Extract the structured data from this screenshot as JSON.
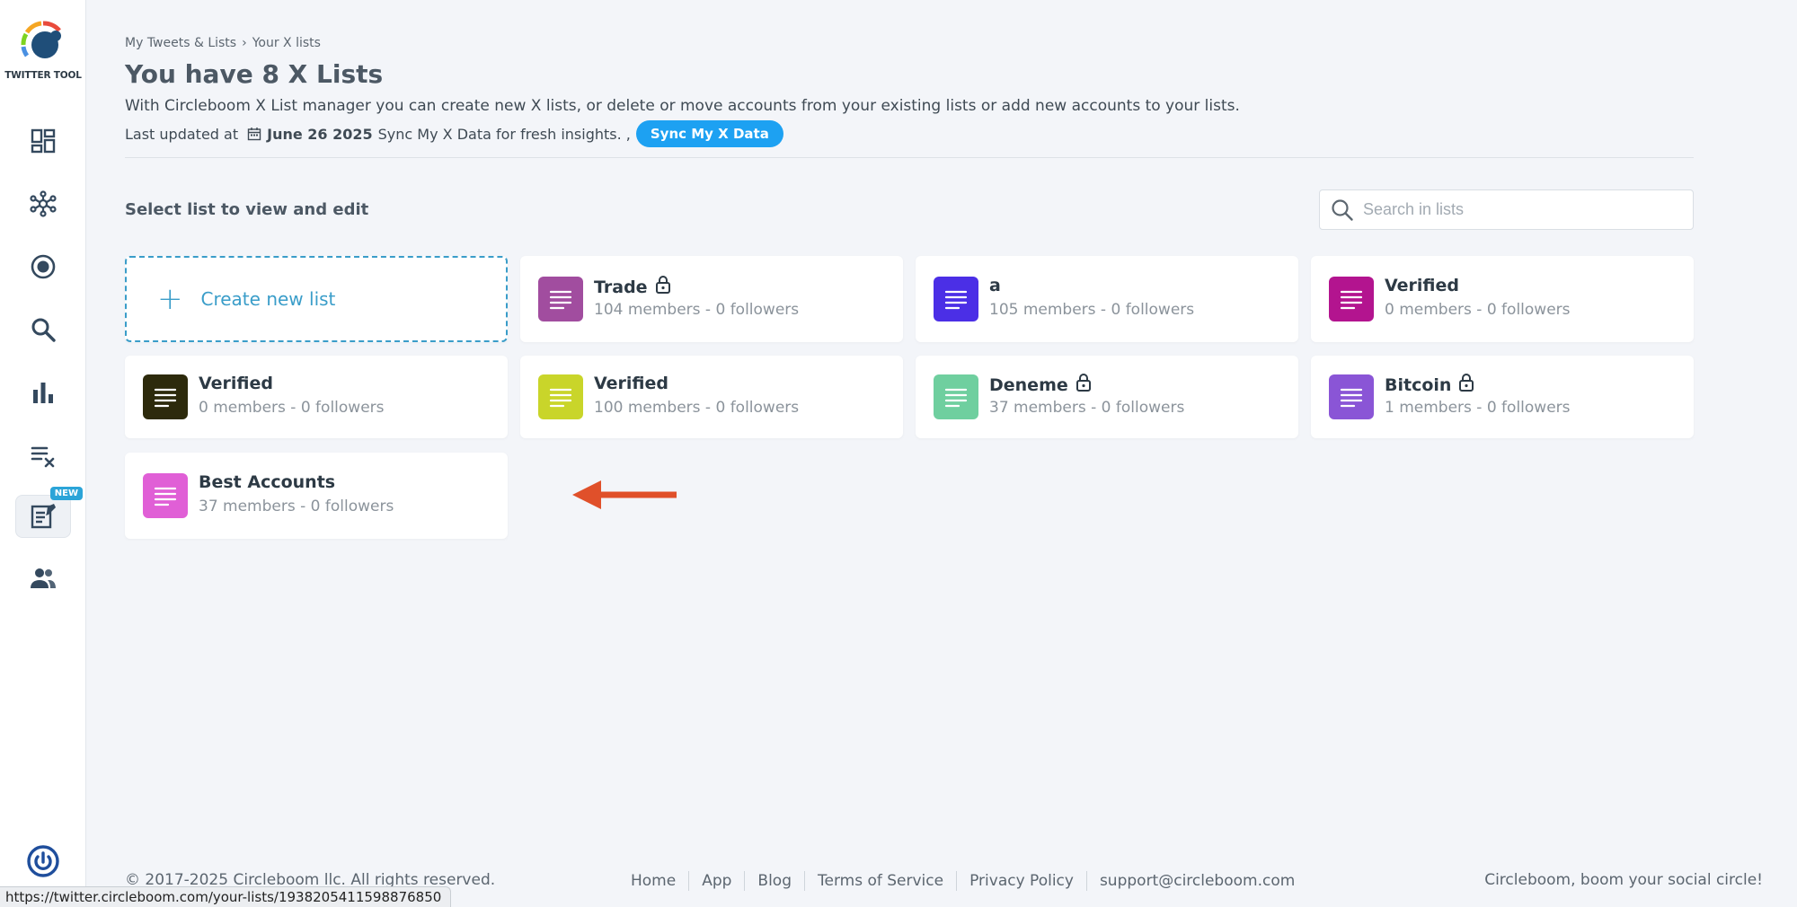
{
  "app": {
    "logo_text": "TWITTER TOOL",
    "new_badge": "NEW"
  },
  "sidebar": {
    "items": [
      {
        "icon": "dashboard-icon"
      },
      {
        "icon": "network-icon"
      },
      {
        "icon": "target-icon"
      },
      {
        "icon": "search-icon"
      },
      {
        "icon": "bar-chart-icon"
      },
      {
        "icon": "list-remove-icon"
      },
      {
        "icon": "list-edit-icon",
        "active": true
      },
      {
        "icon": "users-icon"
      }
    ]
  },
  "breadcrumb": {
    "parent": "My Tweets & Lists",
    "current": "Your X lists"
  },
  "header": {
    "title": "You have 8 X Lists",
    "description": "With Circleboom X List manager you can create new X lists, or delete or move accounts from your existing lists or add new accounts to your lists.",
    "updated_label": "Last updated at",
    "updated_date": "June 26 2025",
    "updated_suffix": "Sync My X Data for fresh insights. ,",
    "sync_button": "Sync My X Data"
  },
  "section": {
    "title": "Select list to view and edit"
  },
  "search": {
    "placeholder": "Search in lists",
    "value": ""
  },
  "create_card": {
    "label": "Create new list"
  },
  "lists": [
    {
      "name": "Trade",
      "meta": "104 members - 0 followers",
      "color": "#a14d9f",
      "private": true
    },
    {
      "name": "a",
      "meta": "105 members - 0 followers",
      "color": "#4b2fe6",
      "private": false
    },
    {
      "name": "Verified",
      "meta": "0 members - 0 followers",
      "color": "#b3148f",
      "private": false
    },
    {
      "name": "Verified",
      "meta": "0 members - 0 followers",
      "color": "#2d2a0c",
      "private": false
    },
    {
      "name": "Verified",
      "meta": "100 members - 0 followers",
      "color": "#c9d52a",
      "private": false
    },
    {
      "name": "Deneme",
      "meta": "37 members - 0 followers",
      "color": "#6fcf9f",
      "private": true
    },
    {
      "name": "Bitcoin",
      "meta": "1 members - 0 followers",
      "color": "#8a55d6",
      "private": true
    },
    {
      "name": "Best Accounts",
      "meta": "37 members - 0 followers",
      "color": "#e05fd6",
      "private": false
    }
  ],
  "footer": {
    "copyright": "© 2017-2025 Circleboom llc. All rights reserved.",
    "links": [
      "Home",
      "App",
      "Blog",
      "Terms of Service",
      "Privacy Policy",
      "support@circleboom.com"
    ],
    "tagline": "Circleboom, boom your social circle!"
  },
  "status_bar": {
    "url": "https://twitter.circleboom.com/your-lists/1938205411598876850"
  },
  "colors": {
    "accent": "#1da1f2",
    "create_border": "#3a9dc9",
    "arrow": "#e0502a"
  }
}
